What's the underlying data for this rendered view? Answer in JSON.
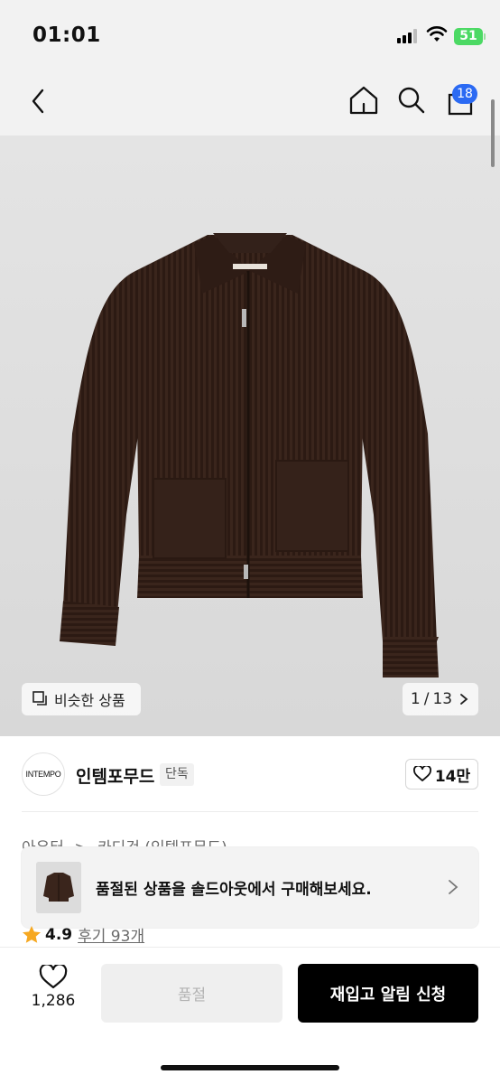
{
  "status_bar": {
    "time": "01:01",
    "battery": "51"
  },
  "nav": {
    "back_icon": "chevron-left-icon",
    "home_icon": "home-icon",
    "search_icon": "search-icon",
    "cart_icon": "bag-icon",
    "cart_badge": "18"
  },
  "gallery": {
    "similar_label": "비슷한 상품",
    "page_current": "1",
    "page_sep": "/",
    "page_total": "13"
  },
  "brand": {
    "logo_text": "INTEMPO",
    "name": "인템포무드",
    "tag": "단독",
    "likes": "14만"
  },
  "breadcrumb": {
    "items": [
      "아우터",
      "카디건 (인템포무드)"
    ],
    "separator": ">"
  },
  "soldout_banner": {
    "message": "품절된 상품을 솔드아웃에서 구매해보세요."
  },
  "rating": {
    "score": "4.9",
    "reviews": "후기 93개",
    "star_color": "#f6a821"
  },
  "bottom_bar": {
    "wish_count": "1,286",
    "soldout_label": "품절",
    "restock_label": "재입고 알림 신청"
  },
  "colors": {
    "accent_badge": "#2b6af3",
    "primary_button": "#000000",
    "product_knit": "#3a251c"
  }
}
